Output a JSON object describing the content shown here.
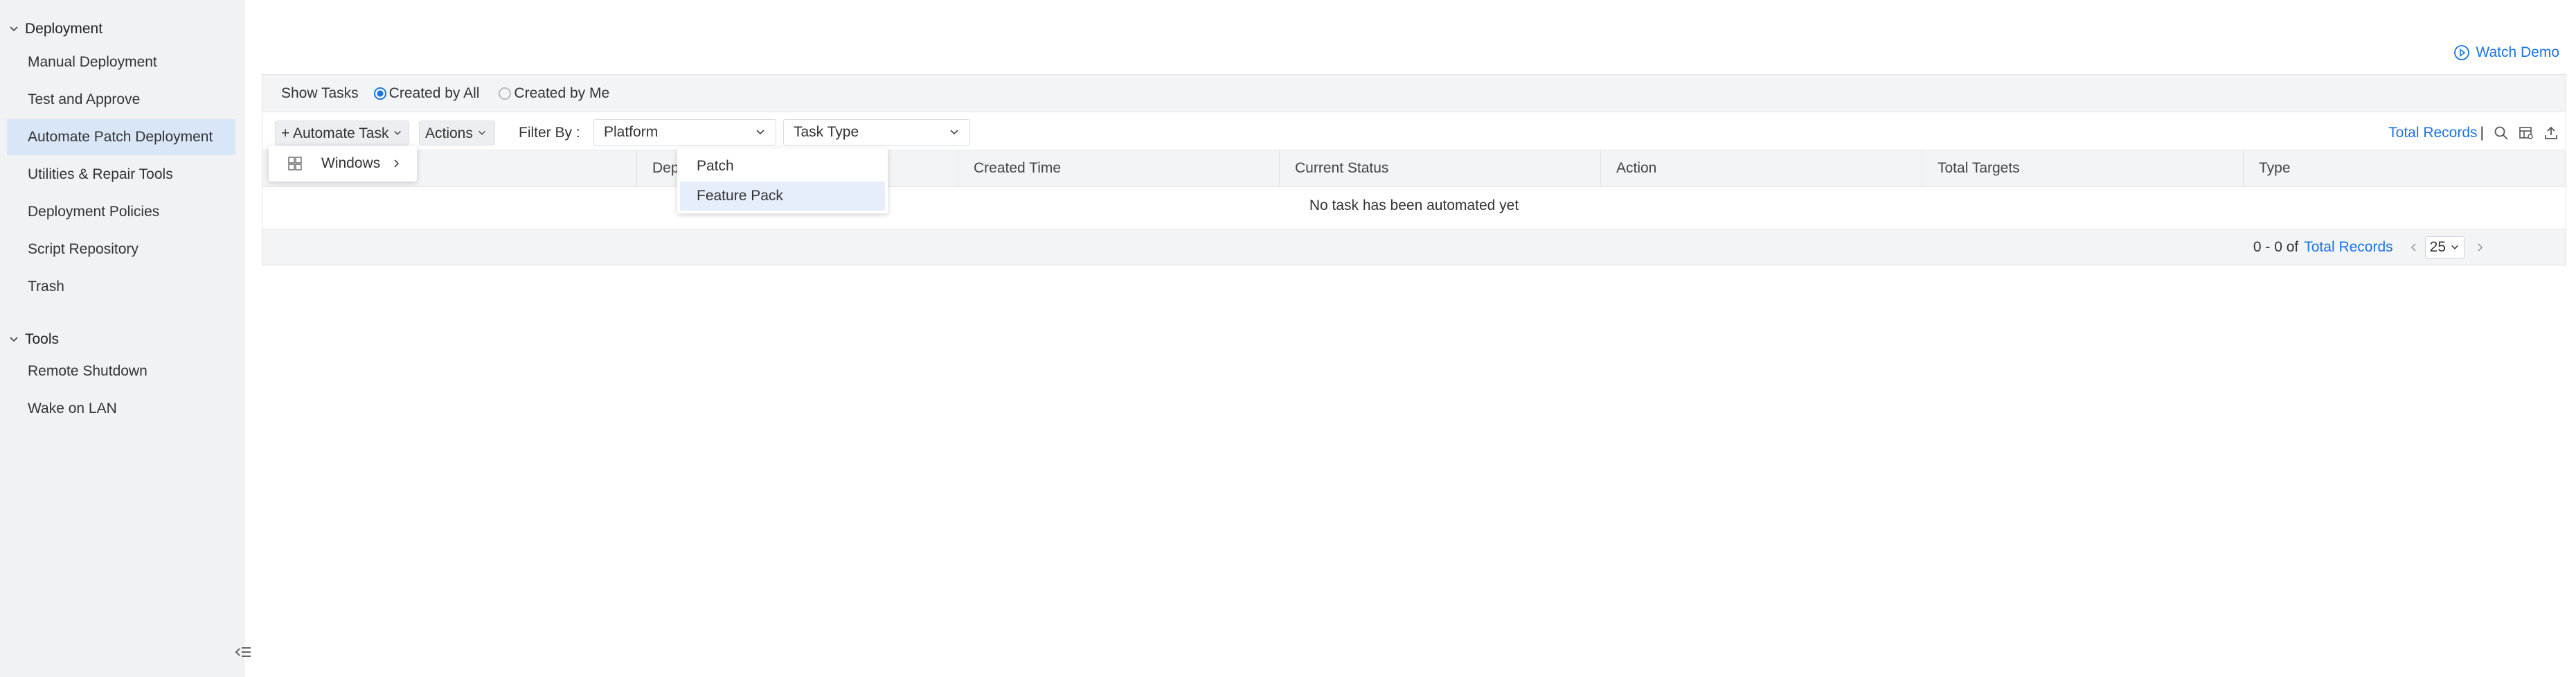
{
  "sidebar": {
    "sections": [
      {
        "title": "Deployment",
        "items": [
          "Manual Deployment",
          "Test and Approve",
          "Automate Patch Deployment",
          "Utilities & Repair Tools",
          "Deployment Policies",
          "Script Repository",
          "Trash"
        ]
      },
      {
        "title": "Tools",
        "items": [
          "Remote Shutdown",
          "Wake on LAN"
        ]
      }
    ],
    "active_item": "Automate Patch Deployment"
  },
  "header": {
    "watch_demo": "Watch Demo"
  },
  "show_tasks": {
    "label": "Show Tasks",
    "options": [
      "Created by All",
      "Created by Me"
    ],
    "selected": "Created by All"
  },
  "toolbar": {
    "automate_task": "Automate Task",
    "actions": "Actions",
    "filter_by": "Filter By :",
    "platform_select": "Platform",
    "task_type_select": "Task Type",
    "total_records": "Total Records",
    "separator": "|"
  },
  "table": {
    "columns": [
      "Deployment Time",
      "Created Time",
      "Current Status",
      "Action",
      "Total Targets",
      "Type"
    ],
    "empty_message": "No task has been automated yet"
  },
  "pagination": {
    "range": "0 - 0 of",
    "total_records": "Total Records",
    "page_size": "25"
  },
  "automate_menu": {
    "item": "Windows"
  },
  "submenu": {
    "items": [
      "Patch",
      "Feature Pack"
    ],
    "highlighted": "Feature Pack"
  },
  "colors": {
    "accent": "#1a73e8",
    "active_bg": "#d9e6f7"
  }
}
